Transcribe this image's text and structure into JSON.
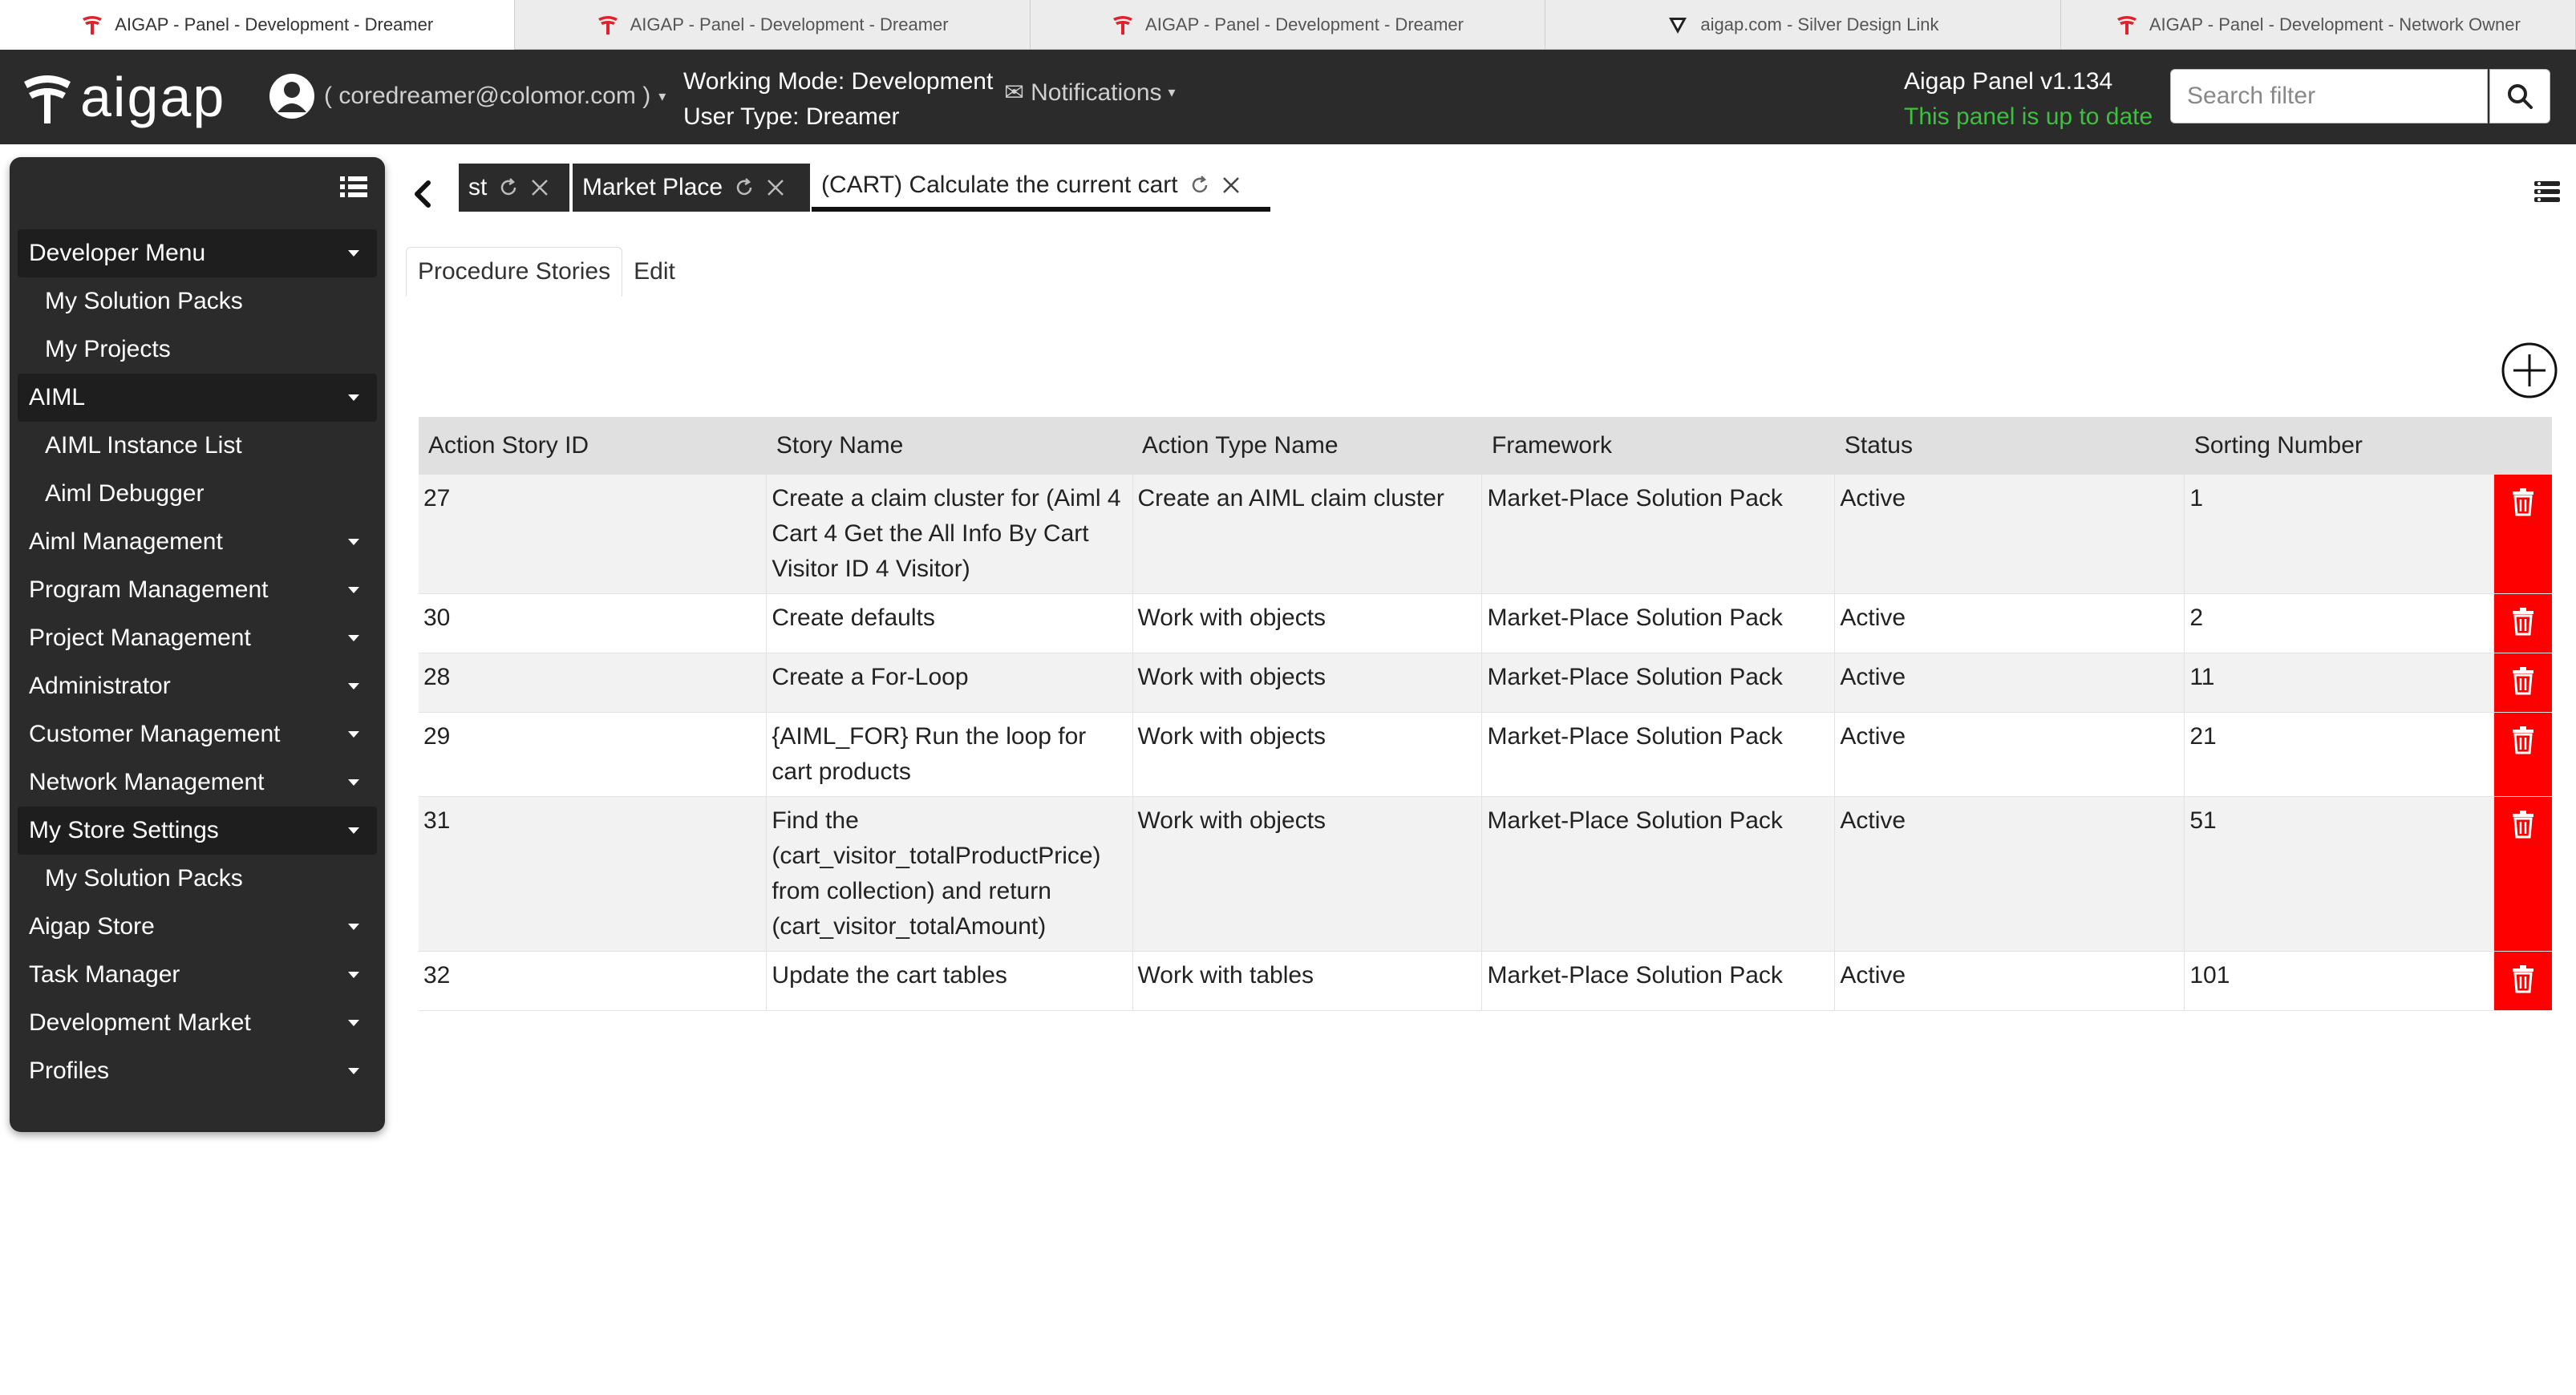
{
  "browser_tabs": [
    {
      "title": "AIGAP - Panel - Development - Dreamer",
      "active": true
    },
    {
      "title": "AIGAP - Panel - Development - Dreamer",
      "active": false
    },
    {
      "title": "AIGAP - Panel - Development - Dreamer",
      "active": false
    },
    {
      "title": "aigap.com - Silver Design Link",
      "active": false
    },
    {
      "title": "AIGAP - Panel - Development - Network Owner",
      "active": false
    }
  ],
  "header": {
    "logo_text": "aigap",
    "user_email": "( coredreamer@colomor.com )",
    "working_mode": "Working Mode: Development",
    "user_type": "User Type: Dreamer",
    "notifications_label": "Notifications",
    "version": "Aigap Panel v1.134",
    "update_status": "This panel is up to date",
    "search_placeholder": "Search filter"
  },
  "sidebar": {
    "items": [
      {
        "label": "Developer Menu",
        "kind": "header",
        "dropdown": true
      },
      {
        "label": "My Solution Packs",
        "kind": "sub",
        "dropdown": false
      },
      {
        "label": "My Projects",
        "kind": "sub",
        "dropdown": false
      },
      {
        "label": "AIML",
        "kind": "header",
        "dropdown": true
      },
      {
        "label": "AIML Instance List",
        "kind": "sub",
        "dropdown": false
      },
      {
        "label": "Aiml Debugger",
        "kind": "sub",
        "dropdown": false
      },
      {
        "label": "Aiml Management",
        "kind": "item",
        "dropdown": true
      },
      {
        "label": "Program Management",
        "kind": "item",
        "dropdown": true
      },
      {
        "label": "Project Management",
        "kind": "item",
        "dropdown": true
      },
      {
        "label": "Administrator",
        "kind": "item",
        "dropdown": true
      },
      {
        "label": "Customer Management",
        "kind": "item",
        "dropdown": true
      },
      {
        "label": "Network Management",
        "kind": "item",
        "dropdown": true
      },
      {
        "label": "My Store Settings",
        "kind": "header",
        "dropdown": true
      },
      {
        "label": "My Solution Packs",
        "kind": "sub",
        "dropdown": false
      },
      {
        "label": "Aigap Store",
        "kind": "item",
        "dropdown": true
      },
      {
        "label": "Task Manager",
        "kind": "item",
        "dropdown": true
      },
      {
        "label": "Development Market",
        "kind": "item",
        "dropdown": true
      },
      {
        "label": "Profiles",
        "kind": "item",
        "dropdown": true
      }
    ]
  },
  "workspace_tabs": [
    {
      "label": "st"
    },
    {
      "label": "Market Place"
    },
    {
      "label": "(CART) Calculate the current cart"
    }
  ],
  "subtabs": [
    "Procedure Stories",
    "Edit"
  ],
  "table": {
    "columns": [
      "Action Story ID",
      "Story Name",
      "Action Type Name",
      "Framework",
      "Status",
      "Sorting Number"
    ],
    "rows": [
      {
        "id": "27",
        "name": "Create a claim cluster for (Aiml 4 Cart 4 Get the All Info By Cart Visitor ID 4 Visitor)",
        "type": "Create an AIML claim cluster",
        "framework": "Market-Place Solution Pack",
        "status": "Active",
        "sort": "1"
      },
      {
        "id": "30",
        "name": "Create defaults",
        "type": "Work with objects",
        "framework": "Market-Place Solution Pack",
        "status": "Active",
        "sort": "2"
      },
      {
        "id": "28",
        "name": "Create a For-Loop",
        "type": "Work with objects",
        "framework": "Market-Place Solution Pack",
        "status": "Active",
        "sort": "11"
      },
      {
        "id": "29",
        "name": "{AIML_FOR} Run the loop for cart products",
        "type": "Work with objects",
        "framework": "Market-Place Solution Pack",
        "status": "Active",
        "sort": "21"
      },
      {
        "id": "31",
        "name": "Find the (cart_visitor_totalProductPrice) from collection) and return (cart_visitor_totalAmount)",
        "type": "Work with objects",
        "framework": "Market-Place Solution Pack",
        "status": "Active",
        "sort": "51"
      },
      {
        "id": "32",
        "name": "Update the cart tables",
        "type": "Work with tables",
        "framework": "Market-Place Solution Pack",
        "status": "Active",
        "sort": "101"
      }
    ]
  },
  "colors": {
    "header_bg": "#2b2b2b",
    "update_green": "#3fbf3f",
    "delete_red": "#ff0000",
    "favicon_red": "#e0202a"
  }
}
